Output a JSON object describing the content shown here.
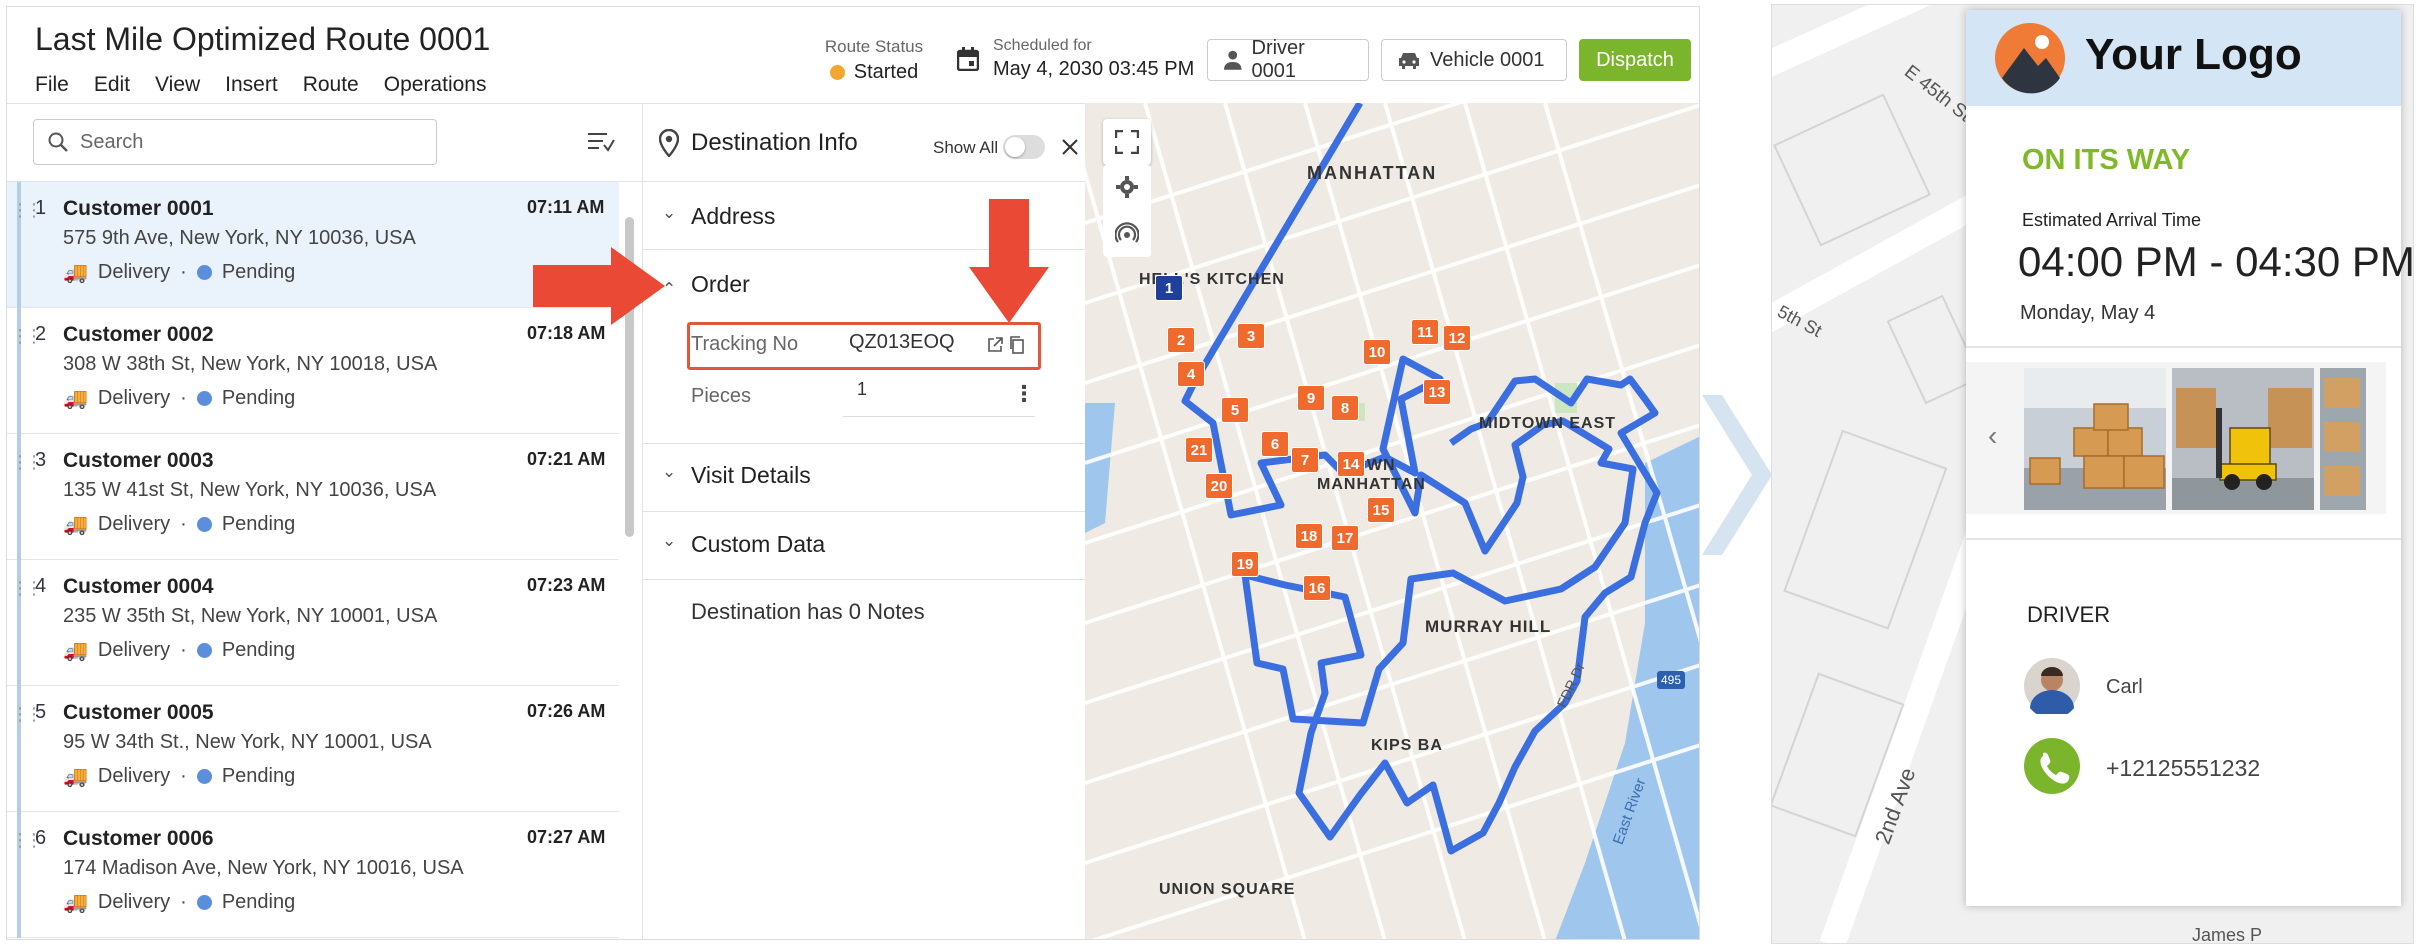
{
  "app": {
    "title": "Last Mile Optimized Route 0001",
    "menu": [
      "File",
      "Edit",
      "View",
      "Insert",
      "Route",
      "Operations"
    ],
    "route_status_label": "Route Status",
    "route_status_value": "Started",
    "route_status_color": "#f0a830",
    "scheduled_label": "Scheduled for",
    "scheduled_value": "May 4, 2030 03:45 PM",
    "driver_label": "Driver 0001",
    "vehicle_label": "Vehicle 0001",
    "dispatch_label": "Dispatch",
    "accent_color": "#7ab52c"
  },
  "sidebar": {
    "search_placeholder": "Search",
    "stops": [
      {
        "num": "1",
        "name": "Customer 0001",
        "time": "07:11 AM",
        "address": "575 9th Ave, New York, NY 10036, USA",
        "type": "Delivery",
        "status": "Pending"
      },
      {
        "num": "2",
        "name": "Customer 0002",
        "time": "07:18 AM",
        "address": "308 W 38th St, New York, NY 10018, USA",
        "type": "Delivery",
        "status": "Pending"
      },
      {
        "num": "3",
        "name": "Customer 0003",
        "time": "07:21 AM",
        "address": "135 W 41st St, New York, NY 10036, USA",
        "type": "Delivery",
        "status": "Pending"
      },
      {
        "num": "4",
        "name": "Customer 0004",
        "time": "07:23 AM",
        "address": "235 W 35th St, New York, NY 10001, USA",
        "type": "Delivery",
        "status": "Pending"
      },
      {
        "num": "5",
        "name": "Customer 0005",
        "time": "07:26 AM",
        "address": "95 W 34th St., New York, NY 10001, USA",
        "type": "Delivery",
        "status": "Pending"
      },
      {
        "num": "6",
        "name": "Customer 0006",
        "time": "07:27 AM",
        "address": "174 Madison Ave, New York, NY 10016, USA",
        "type": "Delivery",
        "status": "Pending"
      }
    ],
    "bullet": "·"
  },
  "panel": {
    "title": "Destination Info",
    "show_all": "Show All",
    "sections": {
      "address": "Address",
      "order": "Order",
      "visit": "Visit Details",
      "custom": "Custom Data"
    },
    "tracking_label": "Tracking No",
    "tracking_value": "QZ013EOQ",
    "pieces_label": "Pieces",
    "pieces_value": "1",
    "notes": "Destination has 0 Notes"
  },
  "map": {
    "labels": {
      "manhattan": "MANHATTAN",
      "hells_kitchen": "HELL'S KITCHEN",
      "midtown_east": "MIDTOWN EAST",
      "midtown": "TOWN",
      "midtown2": "MANHATTAN",
      "murray_hill": "MURRAY HILL",
      "kips_bay": "KIPS BA",
      "union_square": "UNION SQUARE",
      "east_river": "East River",
      "fdr": "FDR Dr",
      "i495": "495"
    },
    "markers": [
      "1",
      "2",
      "3",
      "4",
      "5",
      "6",
      "7",
      "8",
      "9",
      "10",
      "11",
      "12",
      "13",
      "14",
      "15",
      "16",
      "17",
      "18",
      "19",
      "20",
      "21"
    ],
    "route_color": "#3b6fe0",
    "marker_color": "#f06a2e"
  },
  "tracking_page": {
    "logo_text": "Your Logo",
    "status": "ON ITS WAY",
    "eta_label": "Estimated Arrival Time",
    "eta_value": "04:00 PM - 04:30 PM",
    "eta_date": "Monday, May 4",
    "driver_heading": "DRIVER",
    "driver_name": "Carl",
    "driver_phone": "+12125551232",
    "status_color": "#80b928",
    "streets": {
      "e45": "E 45th St",
      "fifth": "5th St",
      "second": "2nd Ave",
      "james": "James P"
    }
  }
}
